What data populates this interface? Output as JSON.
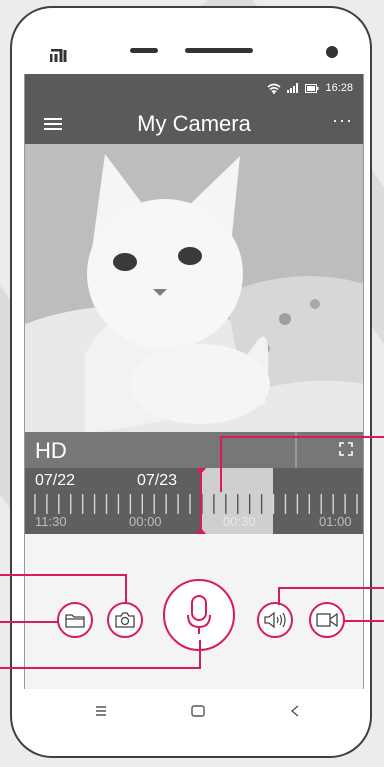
{
  "status_bar": {
    "time": "16:28"
  },
  "app_bar": {
    "title": "My Camera",
    "more_label": "···"
  },
  "video": {
    "quality_label": "HD"
  },
  "timeline": {
    "dates": [
      "07/22",
      "07/23"
    ],
    "times": [
      "11:30",
      "00:00",
      "00:30",
      "01:00"
    ]
  },
  "colors": {
    "accent": "#d81b60",
    "bar": "#5a5a5a",
    "timeline": "#5f5f5f"
  },
  "controls": {
    "icons": [
      "folder-icon",
      "camera-icon",
      "microphone-icon",
      "speaker-icon",
      "video-record-icon"
    ]
  },
  "nav": {
    "icons": [
      "menu-nav-icon",
      "home-nav-icon",
      "back-nav-icon"
    ]
  }
}
